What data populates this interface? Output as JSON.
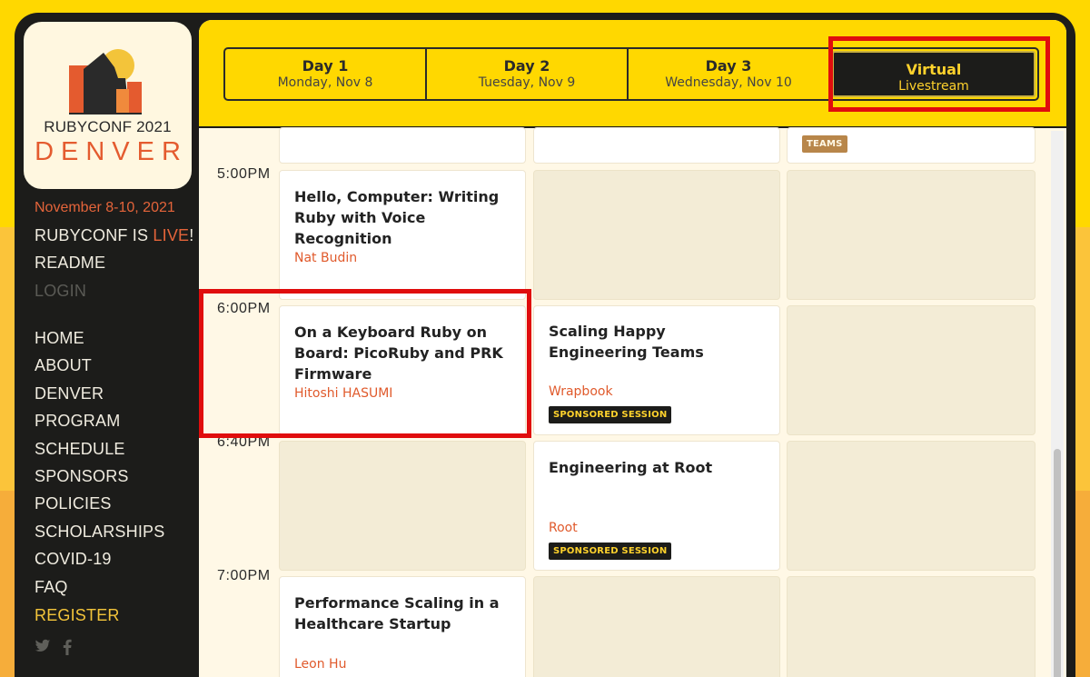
{
  "brand": {
    "title": "RUBYCONF 2021",
    "city": "DENVER",
    "colors": {
      "accent": "#e45b2f",
      "yellow": "#ffd800",
      "dark": "#1c1c1a"
    }
  },
  "sidebar": {
    "dates": "November 8-10, 2021",
    "live_prefix": "RUBYCONF IS ",
    "live_word": "LIVE",
    "live_suffix": "!",
    "readme": "README",
    "login": "LOGIN",
    "nav": [
      "HOME",
      "ABOUT",
      "DENVER",
      "PROGRAM",
      "SCHEDULE",
      "SPONSORS",
      "POLICIES",
      "SCHOLARSHIPS",
      "COVID-19",
      "FAQ"
    ],
    "register": "REGISTER",
    "social_icons": [
      "twitter-icon",
      "facebook-icon"
    ]
  },
  "tabs": [
    {
      "label": "Day 1",
      "sub": "Monday, Nov 8"
    },
    {
      "label": "Day 2",
      "sub": "Tuesday, Nov 9"
    },
    {
      "label": "Day 3",
      "sub": "Wednesday, Nov 10"
    },
    {
      "label": "Virtual",
      "sub": "Livestream",
      "active": true
    }
  ],
  "times": [
    "5:00PM",
    "6:00PM",
    "6:40PM",
    "7:00PM"
  ],
  "sessions": {
    "hello_computer": {
      "title": "Hello, Computer: Writing Ruby with Voice Recognition",
      "speaker": "Nat Budin"
    },
    "keyboard_ruby": {
      "title": "On a Keyboard Ruby on Board: PicoRuby and PRK Firmware",
      "speaker": "Hitoshi HASUMI"
    },
    "scaling_happy": {
      "title": "Scaling Happy Engineering Teams",
      "speaker": "Wrapbook",
      "badge": "SPONSORED SESSION"
    },
    "engineering_root": {
      "title": "Engineering at Root",
      "speaker": "Root",
      "badge": "SPONSORED SESSION"
    },
    "performance_scaling": {
      "title": "Performance Scaling in a Healthcare Startup",
      "speaker": "Leon Hu"
    },
    "teams_badge": "TEAMS"
  }
}
